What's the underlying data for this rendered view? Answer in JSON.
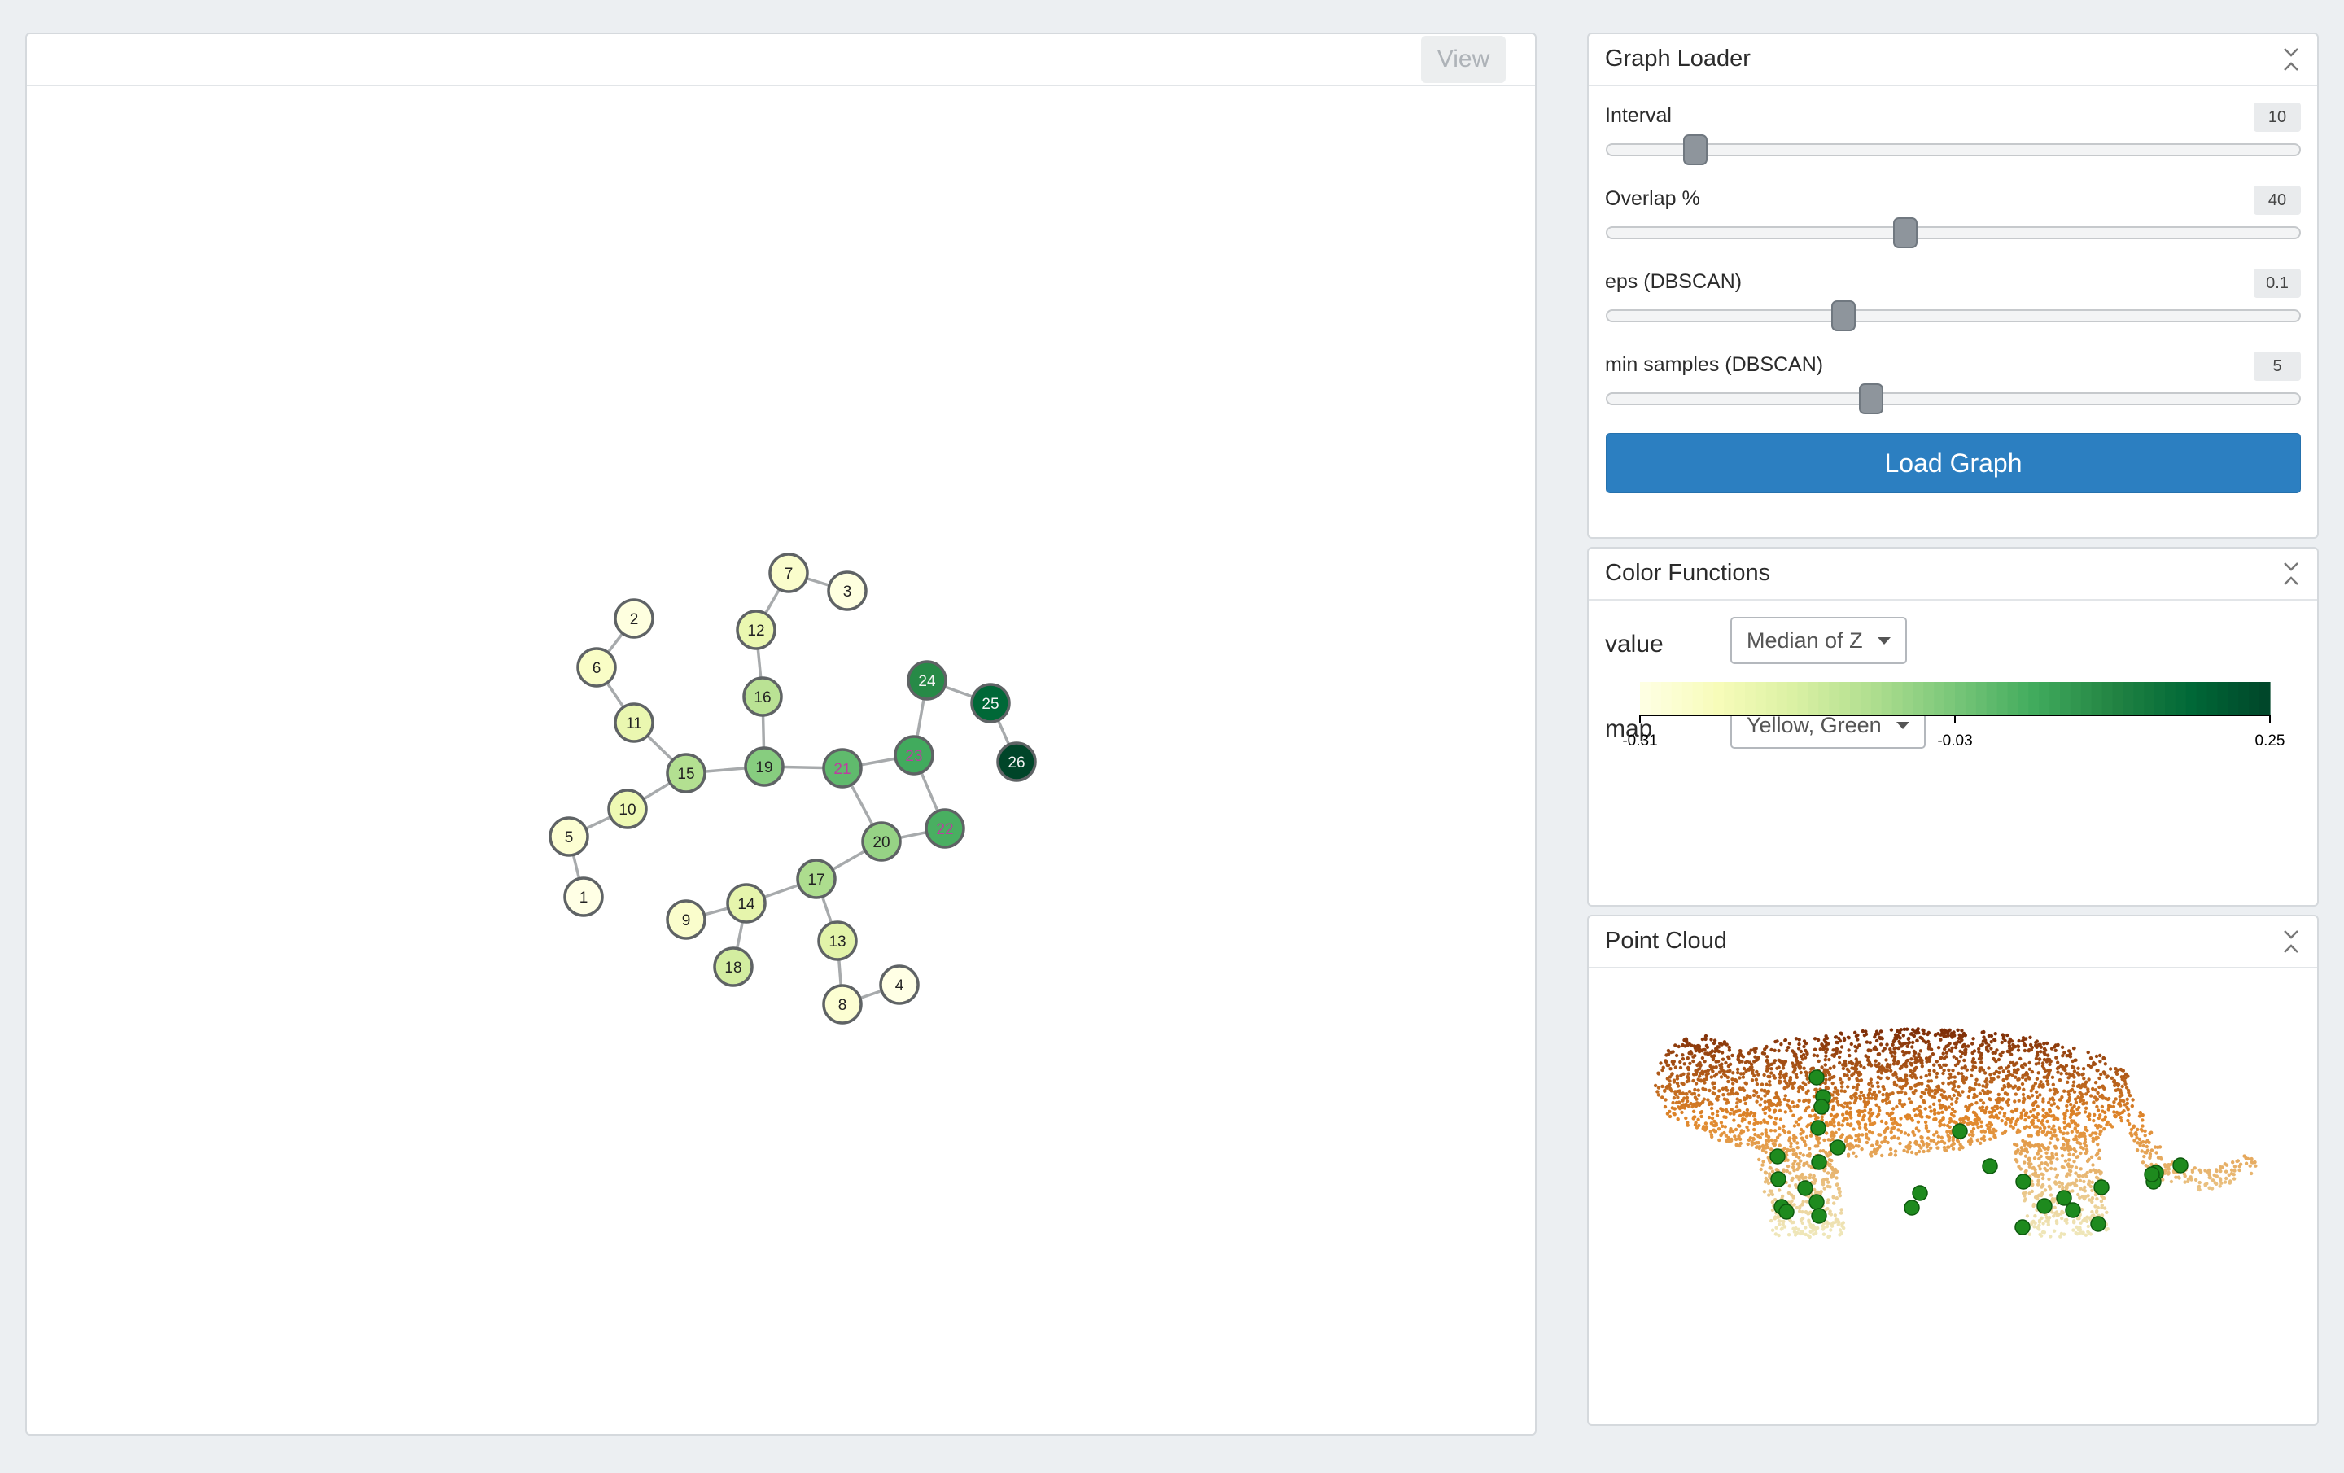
{
  "graph_view": {
    "view_label": "View",
    "nodes": [
      {
        "id": "1",
        "value": -0.31
      },
      {
        "id": "2",
        "value": -0.3
      },
      {
        "id": "3",
        "value": -0.3
      },
      {
        "id": "4",
        "value": -0.31
      },
      {
        "id": "5",
        "value": -0.28
      },
      {
        "id": "6",
        "value": -0.26
      },
      {
        "id": "7",
        "value": -0.27
      },
      {
        "id": "8",
        "value": -0.28
      },
      {
        "id": "9",
        "value": -0.27
      },
      {
        "id": "10",
        "value": -0.22
      },
      {
        "id": "11",
        "value": -0.21
      },
      {
        "id": "12",
        "value": -0.21
      },
      {
        "id": "13",
        "value": -0.19
      },
      {
        "id": "14",
        "value": -0.2
      },
      {
        "id": "15",
        "value": -0.11
      },
      {
        "id": "16",
        "value": -0.12
      },
      {
        "id": "17",
        "value": -0.1
      },
      {
        "id": "18",
        "value": -0.16
      },
      {
        "id": "19",
        "value": -0.05
      },
      {
        "id": "20",
        "value": -0.07
      },
      {
        "id": "21",
        "value": 0.0
      },
      {
        "id": "22",
        "value": 0.03
      },
      {
        "id": "23",
        "value": 0.04
      },
      {
        "id": "24",
        "value": 0.1
      },
      {
        "id": "25",
        "value": 0.18
      },
      {
        "id": "26",
        "value": 0.25
      }
    ],
    "edges": [
      [
        "2",
        "6"
      ],
      [
        "6",
        "11"
      ],
      [
        "11",
        "15"
      ],
      [
        "15",
        "10"
      ],
      [
        "10",
        "5"
      ],
      [
        "5",
        "1"
      ],
      [
        "15",
        "19"
      ],
      [
        "19",
        "16"
      ],
      [
        "16",
        "12"
      ],
      [
        "12",
        "7"
      ],
      [
        "7",
        "3"
      ],
      [
        "19",
        "21"
      ],
      [
        "21",
        "23"
      ],
      [
        "23",
        "24"
      ],
      [
        "24",
        "25"
      ],
      [
        "25",
        "26"
      ],
      [
        "23",
        "22"
      ],
      [
        "22",
        "20"
      ],
      [
        "21",
        "20"
      ],
      [
        "20",
        "17"
      ],
      [
        "17",
        "14"
      ],
      [
        "14",
        "9"
      ],
      [
        "14",
        "18"
      ],
      [
        "17",
        "13"
      ],
      [
        "13",
        "8"
      ],
      [
        "8",
        "4"
      ]
    ]
  },
  "graph_loader": {
    "title": "Graph Loader",
    "sliders": [
      {
        "label": "Interval",
        "value": "10",
        "fraction": 0.127
      },
      {
        "label": "Overlap %",
        "value": "40",
        "fraction": 0.431
      },
      {
        "label": "eps (DBSCAN)",
        "value": "0.1",
        "fraction": 0.341
      },
      {
        "label": "min samples (DBSCAN)",
        "value": "5",
        "fraction": 0.381
      }
    ],
    "load_label": "Load Graph"
  },
  "color_functions": {
    "title": "Color Functions",
    "value_label": "value",
    "value_selected": "Median of Z",
    "map_label": "map",
    "map_selected": "Yellow, Green",
    "scale_ticks": [
      "-0.31",
      "-0.03",
      "0.25"
    ],
    "scale_colors": [
      "#ffffe5",
      "#f7fcb9",
      "#d9f0a3",
      "#addd8e",
      "#78c679",
      "#41ab5d",
      "#238443",
      "#006837",
      "#004529"
    ]
  },
  "point_cloud": {
    "title": "Point Cloud",
    "colors": {
      "top": "#7a2a06",
      "mid": "#e0862a",
      "bottom": "#efe6b8",
      "marker": "#1e8a1e"
    }
  },
  "colors": {
    "accent": "#2c7fc1",
    "panel_border": "#d5d9dd",
    "background": "#eceff2"
  }
}
